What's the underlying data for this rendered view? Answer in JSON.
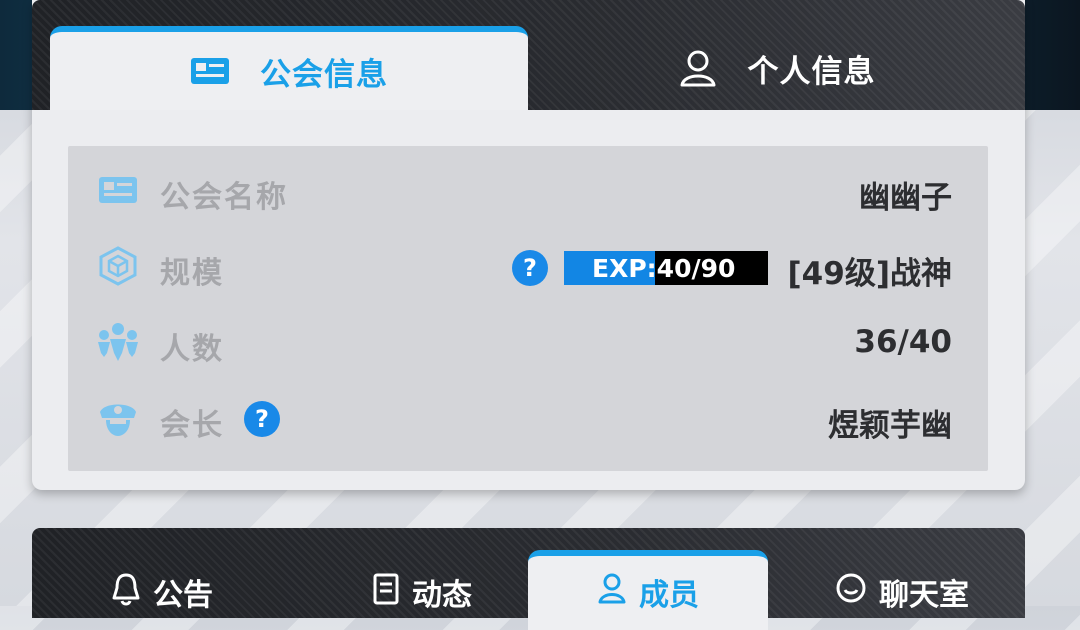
{
  "top_tabs": {
    "guild_info": "公会信息",
    "personal_info": "个人信息"
  },
  "guild": {
    "name_label": "公会名称",
    "name_value": "幽幽子",
    "scale_label": "规模",
    "exp_text": "EXP:40/90",
    "exp_progress": 0.444,
    "level_value": "[49级]战神",
    "members_label": "人数",
    "members_value": "36/40",
    "leader_label": "会长",
    "leader_value": "煜颖芋幽",
    "help_glyph": "?"
  },
  "bottom_tabs": {
    "notice": "公告",
    "news": "动态",
    "members": "成员",
    "chat": "聊天室"
  },
  "colors": {
    "accent": "#1aa0e8",
    "exp_fill": "#1286e4",
    "help": "#1989e8"
  },
  "icons": {
    "id_card": "id-card-icon",
    "person": "person-icon",
    "cube": "cube-icon",
    "people": "people-group-icon",
    "leader": "leader-cap-icon",
    "bell": "bell-icon",
    "document": "document-icon",
    "chat": "chat-bubble-icon"
  }
}
